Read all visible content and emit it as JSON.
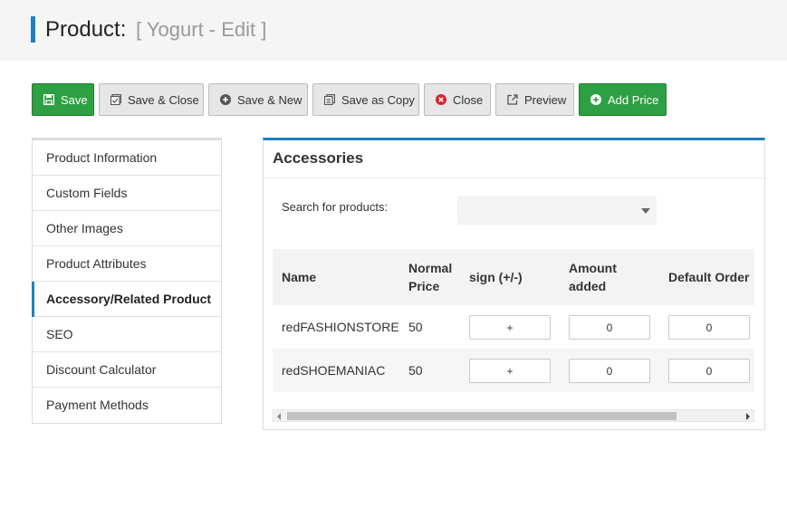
{
  "page": {
    "title": "Product:",
    "subtitle": "[ Yogurt - Edit ]"
  },
  "toolbar": {
    "buttons": [
      {
        "label": "Save",
        "icon": "save-icon"
      },
      {
        "label": "Save & Close",
        "icon": "save-close-icon"
      },
      {
        "label": "Save & New",
        "icon": "plus-circle-icon"
      },
      {
        "label": "Save as Copy",
        "icon": "copy-icon"
      },
      {
        "label": "Close",
        "icon": "close-circle-icon"
      },
      {
        "label": "Preview",
        "icon": "external-link-icon"
      },
      {
        "label": "Add Price",
        "icon": "plus-circle-icon"
      }
    ]
  },
  "sidebar": {
    "items": [
      {
        "label": "Product Information"
      },
      {
        "label": "Custom Fields"
      },
      {
        "label": "Other Images"
      },
      {
        "label": "Product Attributes"
      },
      {
        "label": "Accessory/Related Product",
        "active": true
      },
      {
        "label": "SEO"
      },
      {
        "label": "Discount Calculator"
      },
      {
        "label": "Payment Methods"
      }
    ]
  },
  "panel": {
    "title": "Accessories",
    "search_label": "Search for products:",
    "search_value": ""
  },
  "table": {
    "headers": [
      "Name",
      "Normal Price",
      "sign (+/-)",
      "Amount added",
      "Default Order"
    ],
    "rows": [
      {
        "name": "redFASHIONSTORE",
        "price": "50",
        "sign": "+",
        "amount": "0",
        "order": "0"
      },
      {
        "name": "redSHOEMANIAC",
        "price": "50",
        "sign": "+",
        "amount": "0",
        "order": "0"
      }
    ]
  },
  "colors": {
    "accent": "#1f7fc1",
    "green": "#2ea043"
  }
}
